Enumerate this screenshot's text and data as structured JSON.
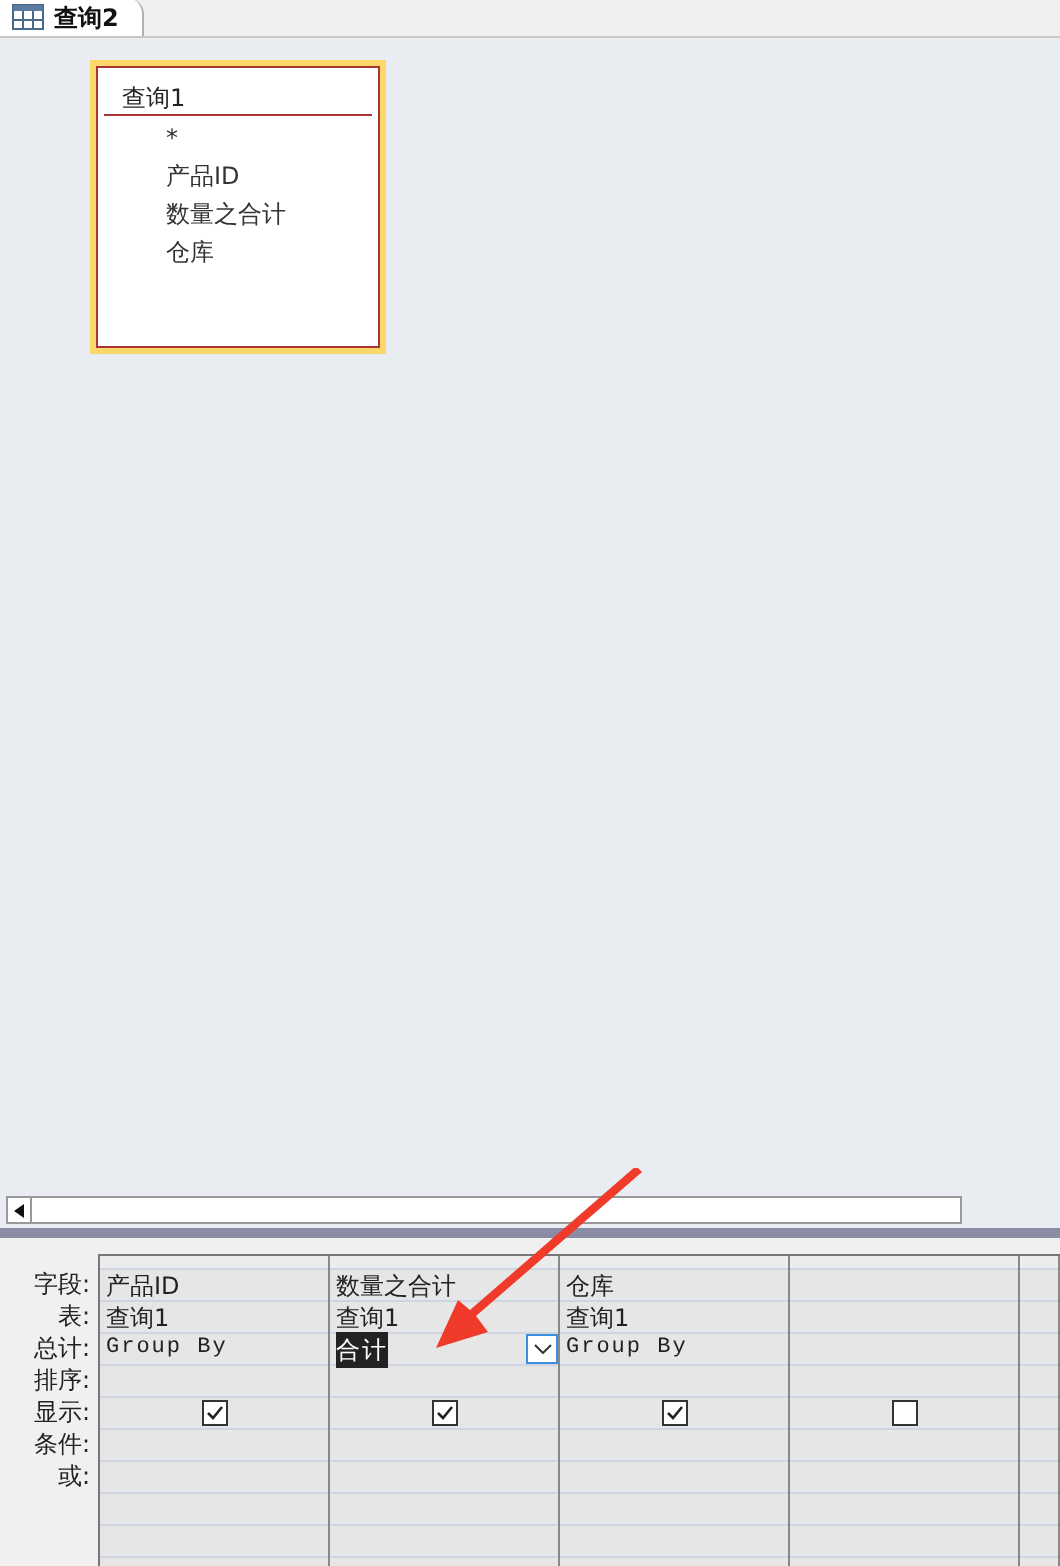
{
  "tab": {
    "title": "查询2",
    "selected": true
  },
  "table_box": {
    "title": "查询1",
    "fields": [
      "*",
      "产品ID",
      "数量之合计",
      "仓库"
    ]
  },
  "grid": {
    "row_labels": [
      "字段:",
      "表:",
      "总计:",
      "排序:",
      "显示:",
      "条件:",
      "或:"
    ],
    "columns": [
      {
        "field": "产品ID",
        "table": "查询1",
        "total": "Group By",
        "selected": false,
        "show": true
      },
      {
        "field": "数量之合计",
        "table": "查询1",
        "total": "合计",
        "selected": true,
        "show": true
      },
      {
        "field": "仓库",
        "table": "查询1",
        "total": "Group By",
        "selected": false,
        "show": true
      },
      {
        "selected": false,
        "show": false
      }
    ]
  }
}
